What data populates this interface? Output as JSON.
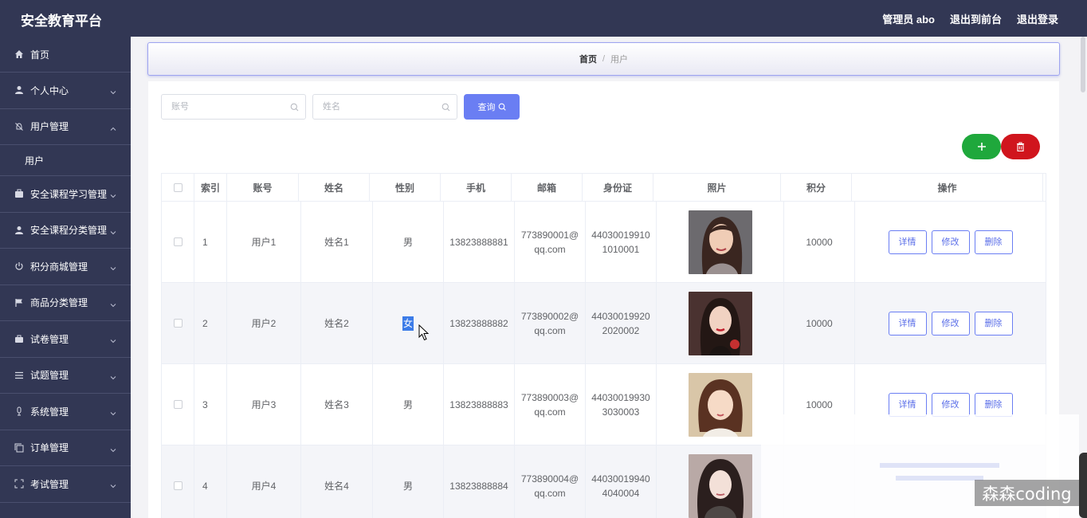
{
  "header": {
    "brand": "安全教育平台",
    "admin": "管理员 abo",
    "front": "退出到前台",
    "logout": "退出登录"
  },
  "sidebar": {
    "items": [
      {
        "label": "首页",
        "icon": "home-icon"
      },
      {
        "label": "个人中心",
        "icon": "user-icon"
      },
      {
        "label": "用户管理",
        "icon": "bell-off-icon",
        "expanded": true,
        "children": [
          "用户"
        ]
      },
      {
        "label": "安全课程学习管理",
        "icon": "briefcase-check-icon"
      },
      {
        "label": "安全课程分类管理",
        "icon": "user-icon"
      },
      {
        "label": "积分商城管理",
        "icon": "power-icon"
      },
      {
        "label": "商品分类管理",
        "icon": "flag-icon"
      },
      {
        "label": "试卷管理",
        "icon": "suitcase-icon"
      },
      {
        "label": "试题管理",
        "icon": "menu-icon"
      },
      {
        "label": "系统管理",
        "icon": "mic-icon"
      },
      {
        "label": "订单管理",
        "icon": "copy-icon"
      },
      {
        "label": "考试管理",
        "icon": "crop-icon"
      }
    ]
  },
  "breadcrumb": {
    "home": "首页",
    "sep": "/",
    "current": "用户"
  },
  "search": {
    "account_placeholder": "账号",
    "name_placeholder": "姓名",
    "query_label": "查询"
  },
  "table": {
    "headers": [
      "索引",
      "账号",
      "姓名",
      "性别",
      "手机",
      "邮箱",
      "身份证",
      "照片",
      "积分",
      "操作"
    ],
    "rows": [
      {
        "index": "1",
        "account": "用户1",
        "name": "姓名1",
        "gender": "男",
        "phone": "13823888881",
        "email": "773890001@qq.com",
        "idcard": "440300199101010001",
        "points": "10000"
      },
      {
        "index": "2",
        "account": "用户2",
        "name": "姓名2",
        "gender": "女",
        "phone": "13823888882",
        "email": "773890002@qq.com",
        "idcard": "440300199202020002",
        "points": "10000"
      },
      {
        "index": "3",
        "account": "用户3",
        "name": "姓名3",
        "gender": "男",
        "phone": "13823888883",
        "email": "773890003@qq.com",
        "idcard": "440300199303030003",
        "points": "10000"
      },
      {
        "index": "4",
        "account": "用户4",
        "name": "姓名4",
        "gender": "男",
        "phone": "13823888884",
        "email": "773890004@qq.com",
        "idcard": "440300199404040004",
        "points": ""
      }
    ],
    "actions": {
      "detail": "详情",
      "edit": "修改",
      "delete": "删除"
    }
  },
  "watermark": "森森coding",
  "colors": {
    "sidebar_bg": "#323754",
    "primary": "#6a7ef3",
    "add": "#1fa83c",
    "danger": "#d0151d"
  }
}
